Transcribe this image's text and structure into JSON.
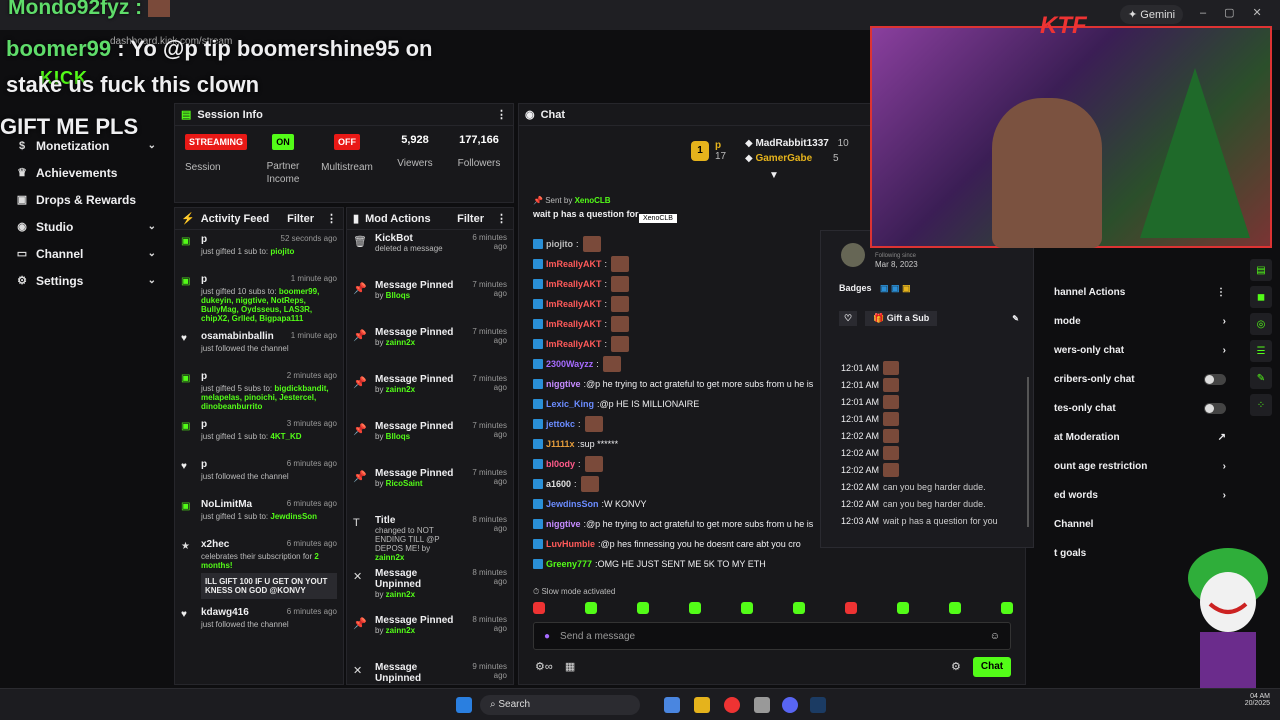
{
  "browser": {
    "url": "dashboard.kick.com/stream",
    "gemini_label": "Gemini",
    "brand": "KICK"
  },
  "overlay": {
    "line1_user": "Mondo92fyz :",
    "line2_user": "boomer99",
    "line2_msg": " : Yo @p tip boomershine95 on",
    "line3": "stake us fuck this clown",
    "line4": "GIFT ME PLS",
    "webcam_brand": "KTF"
  },
  "sidebar": {
    "items": [
      {
        "label": "Monetization",
        "icon": "dollar-icon"
      },
      {
        "label": "Achievements",
        "icon": "trophy-icon"
      },
      {
        "label": "Drops & Rewards",
        "icon": "gift-icon"
      },
      {
        "label": "Studio",
        "icon": "studio-icon"
      },
      {
        "label": "Channel",
        "icon": "channel-icon"
      },
      {
        "label": "Settings",
        "icon": "gear-icon"
      }
    ]
  },
  "session": {
    "title": "Session Info",
    "streaming_badge": "STREAMING",
    "session_label": "Session",
    "partner_badge": "ON",
    "partner_label": "Partner Income",
    "multistream_badge": "OFF",
    "multistream_label": "Multistream",
    "viewers": "5,928",
    "viewers_label": "Viewers",
    "followers": "177,166",
    "followers_label": "Followers"
  },
  "activity": {
    "title": "Activity Feed",
    "filter": "Filter",
    "items": [
      {
        "icon": "gift-icon",
        "name": "p",
        "time": "52 seconds ago",
        "desc": "just gifted 1 sub to: ",
        "extra": "piojito"
      },
      {
        "icon": "gift-icon",
        "name": "p",
        "time": "1 minute ago",
        "desc": "just gifted 10 subs to: ",
        "extra": "boomer99, dukeyin, niggtive, NotReps, BullyMag, Oydsseus, LAS3R, chipX2, Grlled, Bigpapa111"
      },
      {
        "icon": "heart-icon",
        "name": "osamabinballin",
        "time": "1 minute ago",
        "desc": "just followed the channel",
        "extra": ""
      },
      {
        "icon": "gift-icon",
        "name": "p",
        "time": "2 minutes ago",
        "desc": "just gifted 5 subs to: ",
        "extra": "bigdickbandit, melapelas, pinoichi, Jestercel, dinobeanburrito"
      },
      {
        "icon": "gift-icon",
        "name": "p",
        "time": "3 minutes ago",
        "desc": "just gifted 1 sub to: ",
        "extra": "4KT_KD"
      },
      {
        "icon": "heart-icon",
        "name": "p",
        "time": "6 minutes ago",
        "desc": "just followed the channel",
        "extra": ""
      },
      {
        "icon": "gift-icon",
        "name": "NoLimitMa",
        "time": "6 minutes ago",
        "desc": "just gifted 1 sub to: ",
        "extra": "JewdinsSon"
      },
      {
        "icon": "star-icon",
        "name": "x2hec",
        "time": "6 minutes ago",
        "desc": "celebrates their subscription for ",
        "extra": "2 months!",
        "box": "ILL GIFT 100 IF U GET ON YOUT KNESS ON GOD @KONVY"
      },
      {
        "icon": "heart-icon",
        "name": "kdawg416",
        "time": "6 minutes ago",
        "desc": "just followed the channel",
        "extra": ""
      }
    ]
  },
  "mod": {
    "title": "Mod Actions",
    "filter": "Filter",
    "items": [
      {
        "icon": "trash-icon",
        "name": "KickBot",
        "time": "6 minutes ago",
        "by": "deleted a message",
        "who": ""
      },
      {
        "icon": "pin-icon",
        "name": "Message Pinned",
        "time": "7 minutes ago",
        "by": "by ",
        "who": "Blloqs"
      },
      {
        "icon": "pin-icon",
        "name": "Message Pinned",
        "time": "7 minutes ago",
        "by": "by ",
        "who": "zainn2x"
      },
      {
        "icon": "pin-icon",
        "name": "Message Pinned",
        "time": "7 minutes ago",
        "by": "by ",
        "who": "zainn2x"
      },
      {
        "icon": "pin-icon",
        "name": "Message Pinned",
        "time": "7 minutes ago",
        "by": "by ",
        "who": "Blloqs"
      },
      {
        "icon": "pin-icon",
        "name": "Message Pinned",
        "time": "7 minutes ago",
        "by": "by ",
        "who": "RicoSaint"
      },
      {
        "icon": "title-icon",
        "name": "Title",
        "time": "8 minutes ago",
        "by": "changed to NOT ENDING TILL @P DEPOS ME! by ",
        "who": "zainn2x"
      },
      {
        "icon": "unpin-icon",
        "name": "Message Unpinned",
        "time": "8 minutes ago",
        "by": "by ",
        "who": "zainn2x"
      },
      {
        "icon": "pin-icon",
        "name": "Message Pinned",
        "time": "8 minutes ago",
        "by": "by ",
        "who": "zainn2x"
      },
      {
        "icon": "unpin-icon",
        "name": "Message Unpinned",
        "time": "9 minutes ago",
        "by": "",
        "who": ""
      }
    ]
  },
  "chat": {
    "title": "Chat",
    "leader_rank": "1",
    "leader_name": "p",
    "leader_count": "17",
    "top2_name": "MadRabbit1337",
    "top2_count": "10",
    "top3_name": "GamerGabe",
    "top3_count": "5",
    "pinned_label": "Sent by",
    "pinned_user": "XenoCLB",
    "pinned_msg": "wait p has a question for",
    "tooltip": "XenoCLB",
    "messages": [
      {
        "user": "piojito",
        "color": "#bbb",
        "text": ""
      },
      {
        "user": "ImReallyAKT",
        "color": "#ff5a5a",
        "text": ""
      },
      {
        "user": "ImReallyAKT",
        "color": "#ff5a5a",
        "text": ""
      },
      {
        "user": "ImReallyAKT",
        "color": "#ff5a5a",
        "text": ""
      },
      {
        "user": "ImReallyAKT",
        "color": "#ff5a5a",
        "text": ""
      },
      {
        "user": "ImReallyAKT",
        "color": "#ff5a5a",
        "text": ""
      },
      {
        "user": "2300Wayzz",
        "color": "#a66bff",
        "text": ""
      },
      {
        "user": "niggtive",
        "color": "#c58bff",
        "text": "@p he trying to act grateful to get more subs from u he is"
      },
      {
        "user": "Lexic_King",
        "color": "#6b8cff",
        "text": "@p HE IS MILLIONAIRE"
      },
      {
        "user": "jettokc",
        "color": "#6b8cff",
        "text": ""
      },
      {
        "user": "J1111x",
        "color": "#e39b3b",
        "text": "sup ******"
      },
      {
        "user": "bl0ody",
        "color": "#ff5a8a",
        "text": ""
      },
      {
        "user": "a1600",
        "color": "#e0e0e0",
        "text": ""
      },
      {
        "user": "JewdinsSon",
        "color": "#6b8cff",
        "text": "W KONVY"
      },
      {
        "user": "niggtive",
        "color": "#c58bff",
        "text": "@p he trying to act grateful to get more subs from u he is"
      },
      {
        "user": "LuvHumble",
        "color": "#ff5a5a",
        "text": "@p hes finnessing you he doesnt care abt you cro"
      },
      {
        "user": "Greeny777",
        "color": "#53fc18",
        "text": "OMG HE JUST SENT ME 5K TO MY ETH"
      }
    ],
    "slow_mode": "Slow mode activated",
    "input_placeholder": "Send a message",
    "send_label": "Chat"
  },
  "profile": {
    "following_label": "Following since",
    "following_date": "Mar 8, 2023",
    "badges_label": "Badges",
    "gift_label": "Gift a Sub",
    "log": [
      {
        "time": "12:01 AM",
        "text": ""
      },
      {
        "time": "12:01 AM",
        "text": ""
      },
      {
        "time": "12:01 AM",
        "text": ""
      },
      {
        "time": "12:01 AM",
        "text": ""
      },
      {
        "time": "12:02 AM",
        "text": ""
      },
      {
        "time": "12:02 AM",
        "text": ""
      },
      {
        "time": "12:02 AM",
        "text": ""
      },
      {
        "time": "12:02 AM",
        "text": "can you beg harder dude."
      },
      {
        "time": "12:02 AM",
        "text": "can you beg harder dude."
      },
      {
        "time": "12:03 AM",
        "text": "wait p has a question for you"
      }
    ]
  },
  "channel_actions": {
    "title": "hannel Actions",
    "items": [
      {
        "label": "mode",
        "control": "chevron"
      },
      {
        "label": "wers-only chat",
        "control": "chevron"
      },
      {
        "label": "cribers-only chat",
        "control": "toggle"
      },
      {
        "label": "tes-only chat",
        "control": "toggle"
      },
      {
        "label": "at Moderation",
        "control": "link"
      },
      {
        "label": "ount age restriction",
        "control": "chevron"
      },
      {
        "label": "ed words",
        "control": "chevron"
      },
      {
        "label": "Channel",
        "control": "none"
      },
      {
        "label": "t goals",
        "control": "none"
      }
    ]
  },
  "taskbar": {
    "search": "Search",
    "time": "04 AM",
    "date": "20/2025"
  },
  "colors": {
    "accent": "#53fc18",
    "streaming": "#e91916",
    "bg": "#0e0e10",
    "panel": "#18181b"
  }
}
